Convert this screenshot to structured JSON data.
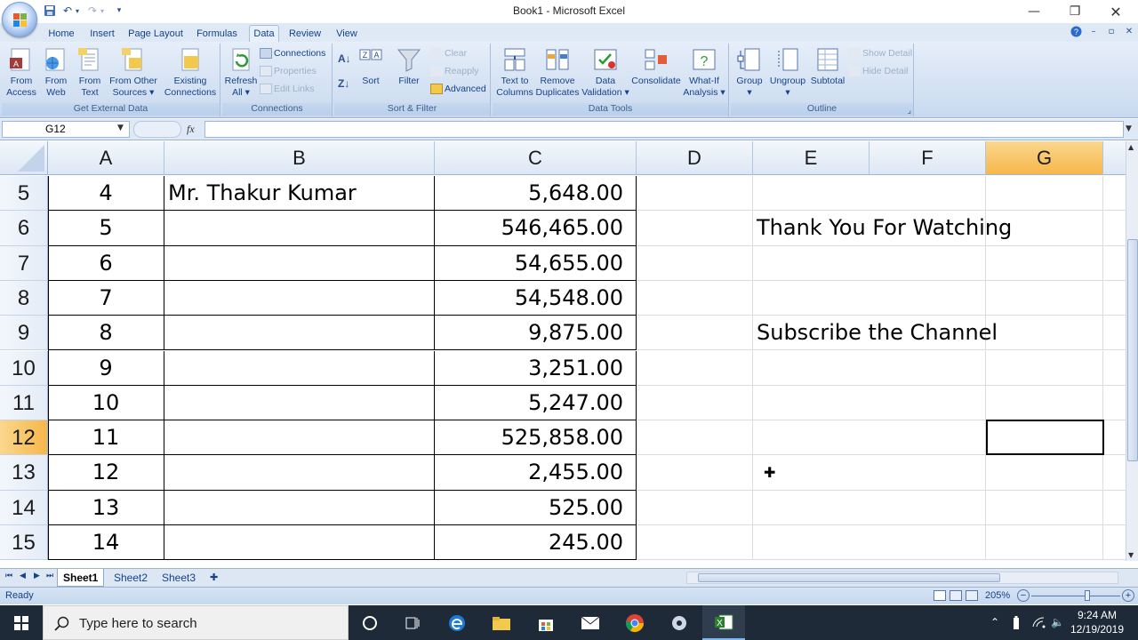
{
  "window": {
    "title": "Book1 - Microsoft Excel"
  },
  "ribbon_tabs": [
    "Home",
    "Insert",
    "Page Layout",
    "Formulas",
    "Data",
    "Review",
    "View"
  ],
  "active_tab": "Data",
  "ribbon": {
    "get_external_data": {
      "label": "Get External Data",
      "buttons": [
        {
          "line1": "From",
          "line2": "Access"
        },
        {
          "line1": "From",
          "line2": "Web"
        },
        {
          "line1": "From",
          "line2": "Text"
        },
        {
          "line1": "From Other",
          "line2": "Sources ▾"
        },
        {
          "line1": "Existing",
          "line2": "Connections"
        }
      ]
    },
    "connections": {
      "label": "Connections",
      "refresh": {
        "line1": "Refresh",
        "line2": "All ▾"
      },
      "connections": "Connections",
      "properties": "Properties",
      "edit_links": "Edit Links"
    },
    "sort_filter": {
      "label": "Sort & Filter",
      "sort": "Sort",
      "filter": "Filter",
      "clear": "Clear",
      "reapply": "Reapply",
      "advanced": "Advanced"
    },
    "data_tools": {
      "label": "Data Tools",
      "buttons": [
        {
          "line1": "Text to",
          "line2": "Columns"
        },
        {
          "line1": "Remove",
          "line2": "Duplicates"
        },
        {
          "line1": "Data",
          "line2": "Validation ▾"
        },
        {
          "line1": "Consolidate",
          "line2": ""
        },
        {
          "line1": "What-If",
          "line2": "Analysis ▾"
        }
      ]
    },
    "outline": {
      "label": "Outline",
      "group": {
        "line1": "Group",
        "line2": "▾"
      },
      "ungroup": {
        "line1": "Ungroup",
        "line2": "▾"
      },
      "subtotal": "Subtotal",
      "show_detail": "Show Detail",
      "hide_detail": "Hide Detail"
    }
  },
  "formula_bar": {
    "name_box": "G12",
    "fx": "fx",
    "formula": ""
  },
  "columns": [
    "A",
    "B",
    "C",
    "D",
    "E",
    "F",
    "G"
  ],
  "selected_column": "G",
  "rows": [
    {
      "num": "5",
      "a": "4",
      "b": "Mr. Thakur Kumar",
      "c": "5,648.00",
      "e": ""
    },
    {
      "num": "6",
      "a": "5",
      "b": "",
      "c": "546,465.00",
      "e": "Thank You For Watching"
    },
    {
      "num": "7",
      "a": "6",
      "b": "",
      "c": "54,655.00",
      "e": ""
    },
    {
      "num": "8",
      "a": "7",
      "b": "",
      "c": "54,548.00",
      "e": ""
    },
    {
      "num": "9",
      "a": "8",
      "b": "",
      "c": "9,875.00",
      "e": "Subscribe the Channel"
    },
    {
      "num": "10",
      "a": "9",
      "b": "",
      "c": "3,251.00",
      "e": ""
    },
    {
      "num": "11",
      "a": "10",
      "b": "",
      "c": "5,247.00",
      "e": ""
    },
    {
      "num": "12",
      "a": "11",
      "b": "",
      "c": "525,858.00",
      "e": ""
    },
    {
      "num": "13",
      "a": "12",
      "b": "",
      "c": "2,455.00",
      "e": ""
    },
    {
      "num": "14",
      "a": "13",
      "b": "",
      "c": "525.00",
      "e": ""
    },
    {
      "num": "15",
      "a": "14",
      "b": "",
      "c": "245.00",
      "e": ""
    }
  ],
  "selected_row": "12",
  "sheets": [
    "Sheet1",
    "Sheet2",
    "Sheet3"
  ],
  "active_sheet": "Sheet1",
  "status": {
    "ready": "Ready",
    "zoom": "205%"
  },
  "taskbar": {
    "search_placeholder": "Type here to search",
    "time": "9:24 AM",
    "date": "12/19/2019"
  },
  "colors": {
    "selected_header": "#f6b74a",
    "ribbon": "#d5e2f3",
    "taskbar": "#1e2a38"
  }
}
